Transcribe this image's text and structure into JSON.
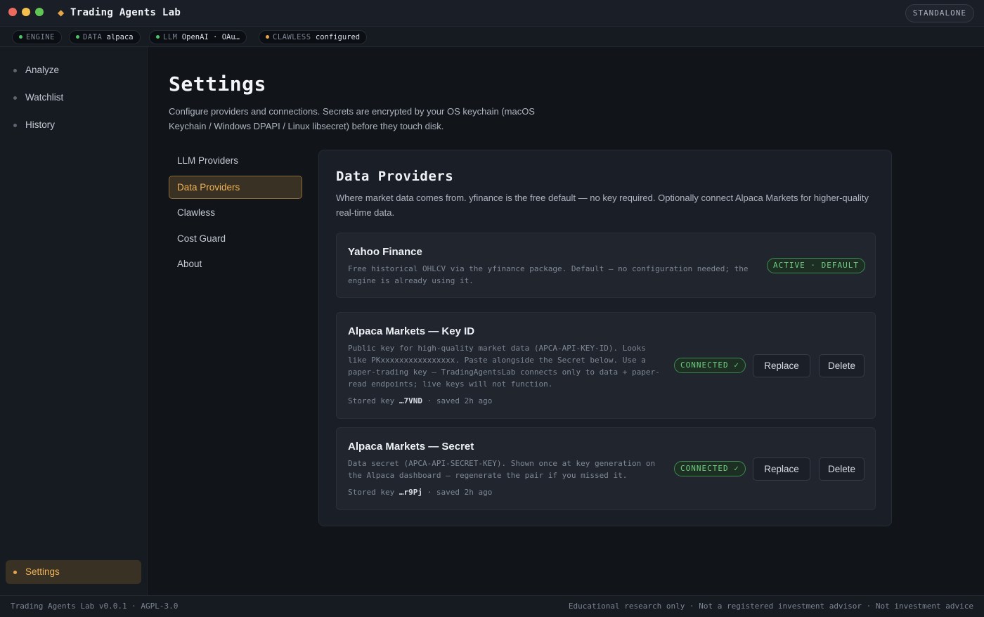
{
  "app": {
    "title": "Trading Agents Lab",
    "mode": "STANDALONE"
  },
  "status": {
    "engine": {
      "key": "ENGINE",
      "value": "",
      "color": "#4cc46a"
    },
    "data": {
      "key": "DATA",
      "value": "alpaca",
      "color": "#4cc46a"
    },
    "llm": {
      "key": "LLM",
      "value": "OpenAI · OAu…",
      "color": "#4cc46a"
    },
    "clawless": {
      "key": "CLAWLESS",
      "value": "configured",
      "color": "#e5a64a"
    }
  },
  "sidebar": {
    "items": [
      {
        "label": "Analyze"
      },
      {
        "label": "Watchlist"
      },
      {
        "label": "History"
      }
    ],
    "settings_label": "Settings"
  },
  "page": {
    "title": "Settings",
    "description": "Configure providers and connections. Secrets are encrypted by your OS keychain (macOS Keychain / Windows DPAPI / Linux libsecret) before they touch disk."
  },
  "subnav": {
    "items": [
      {
        "label": "LLM Providers"
      },
      {
        "label": "Data Providers",
        "active": true
      },
      {
        "label": "Clawless"
      },
      {
        "label": "Cost Guard"
      },
      {
        "label": "About"
      }
    ]
  },
  "panel": {
    "title": "Data Providers",
    "description": "Where market data comes from. yfinance is the free default — no key required. Optionally connect Alpaca Markets for higher-quality real-time data.",
    "cards": [
      {
        "title": "Yahoo Finance",
        "description": "Free historical OHLCV via the yfinance package. Default — no configuration needed; the engine is already using it.",
        "badge": "ACTIVE · DEFAULT"
      },
      {
        "title": "Alpaca Markets — Key ID",
        "description": "Public key for high-quality market data (APCA-API-KEY-ID). Looks like PKxxxxxxxxxxxxxxxx. Paste alongside the Secret below. Use a paper-trading key — TradingAgentsLab connects only to data + paper-read endpoints; live keys will not function.",
        "stored_prefix": "Stored key",
        "stored_key": "…7VND",
        "saved": "· saved 2h ago",
        "badge": "CONNECTED ✓",
        "replace_label": "Replace",
        "delete_label": "Delete"
      },
      {
        "title": "Alpaca Markets — Secret",
        "description": "Data secret (APCA-API-SECRET-KEY). Shown once at key generation on the Alpaca dashboard — regenerate the pair if you missed it.",
        "stored_prefix": "Stored key",
        "stored_key": "…r9Pj",
        "saved": "· saved 2h ago",
        "badge": "CONNECTED ✓",
        "replace_label": "Replace",
        "delete_label": "Delete"
      }
    ]
  },
  "footer": {
    "left": "Trading Agents Lab v0.0.1 · AGPL-3.0",
    "right": "Educational research only · Not a registered investment advisor · Not investment advice"
  },
  "colors": {
    "accent": "#e5a64a",
    "success": "#6fcf82",
    "background": "#111419"
  }
}
